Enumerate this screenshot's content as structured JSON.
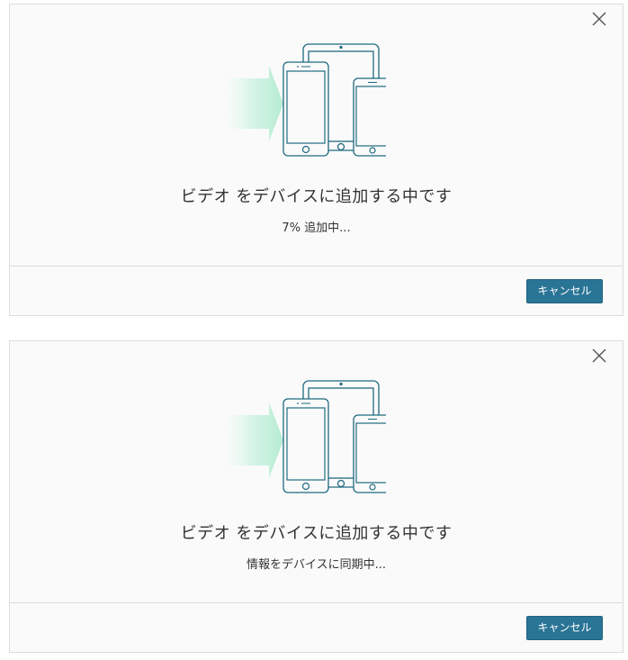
{
  "colors": {
    "accent": "#2a7496",
    "device_stroke": "#1f6a80",
    "arrow_fill": "#bfeed8",
    "dialog_bg": "#fafafa",
    "border": "#dcdcdc"
  },
  "dialogs": [
    {
      "title": "ビデオ をデバイスに追加する中です",
      "status": "7% 追加中...",
      "cancel_label": "キャンセル",
      "close_icon": "close-icon",
      "illustration_icons": [
        "arrow-icon",
        "iphone-icon",
        "ipad-icon",
        "iphone-small-icon"
      ]
    },
    {
      "title": "ビデオ をデバイスに追加する中です",
      "status": "情報をデバイスに同期中...",
      "cancel_label": "キャンセル",
      "close_icon": "close-icon",
      "illustration_icons": [
        "arrow-icon",
        "iphone-icon",
        "ipad-icon",
        "iphone-small-icon"
      ]
    }
  ]
}
